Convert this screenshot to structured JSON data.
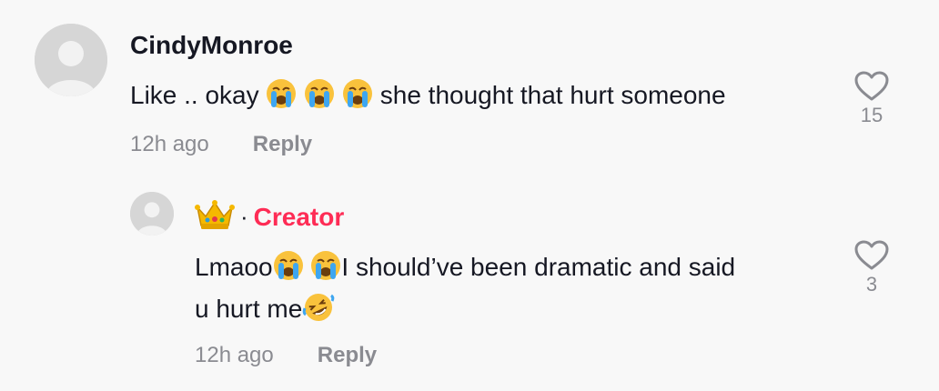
{
  "comments": [
    {
      "username": "CindyMonroe",
      "text_before": "Like .. okay ",
      "emojis": [
        "loudly-crying-face",
        "loudly-crying-face",
        "loudly-crying-face"
      ],
      "text_after": " she thought that hurt someone",
      "time": "12h ago",
      "reply_label": "Reply",
      "likes": "15"
    }
  ],
  "reply": {
    "badge_icon": "crown",
    "separator": "·",
    "creator_label": "Creator",
    "line1_before": "Lmaoo",
    "line1_after": "I should’ve been dramatic and said",
    "line2_before": "u hurt me",
    "time": "12h ago",
    "reply_label": "Reply",
    "likes": "3"
  },
  "colors": {
    "background": "#f8f8f8",
    "creator": "#fe2c55",
    "meta": "#8a8b91"
  }
}
